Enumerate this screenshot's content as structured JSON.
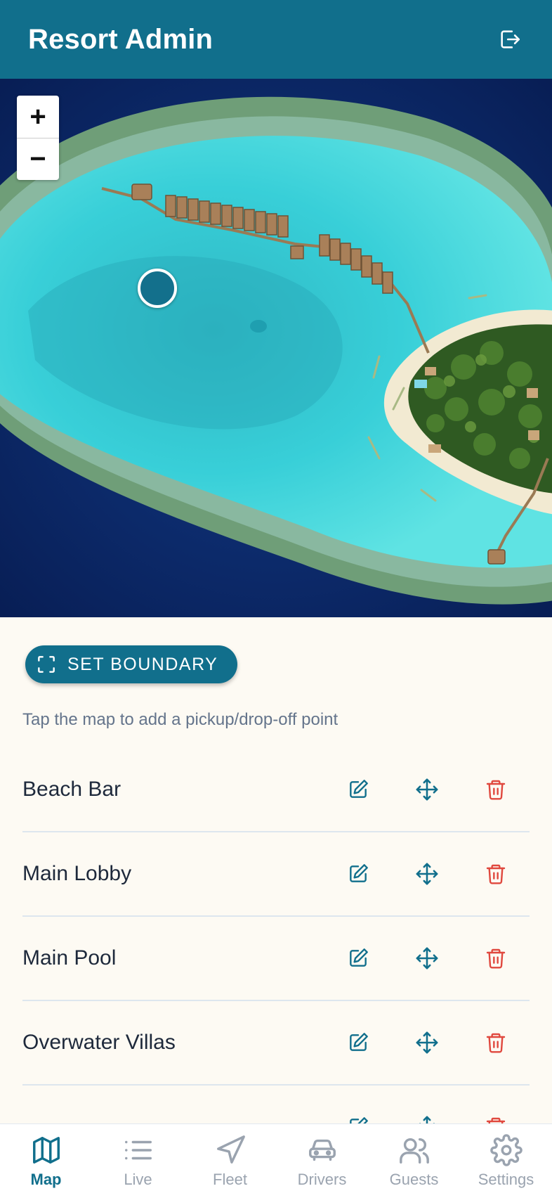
{
  "header": {
    "title": "Resort Admin",
    "logout_icon": "logout-icon"
  },
  "map": {
    "zoom_in_label": "+",
    "zoom_out_label": "−",
    "marker_color": "#13708c"
  },
  "boundary_button": {
    "label": "SET BOUNDARY",
    "icon": "scan-frame-icon"
  },
  "hint": "Tap the map to add a pickup/drop-off point",
  "locations": [
    {
      "name": "Beach Bar"
    },
    {
      "name": "Main Lobby"
    },
    {
      "name": "Main Pool"
    },
    {
      "name": "Overwater Villas"
    },
    {
      "name": ""
    }
  ],
  "nav": [
    {
      "label": "Map",
      "icon": "map-icon",
      "active": true
    },
    {
      "label": "Live",
      "icon": "list-icon",
      "active": false
    },
    {
      "label": "Fleet",
      "icon": "navigation-icon",
      "active": false
    },
    {
      "label": "Drivers",
      "icon": "car-icon",
      "active": false
    },
    {
      "label": "Guests",
      "icon": "users-icon",
      "active": false
    },
    {
      "label": "Settings",
      "icon": "gear-icon",
      "active": false
    }
  ],
  "colors": {
    "primary": "#116f8c",
    "danger": "#e0483e",
    "inactive": "#9aa3af",
    "background": "#fdfaf3"
  }
}
